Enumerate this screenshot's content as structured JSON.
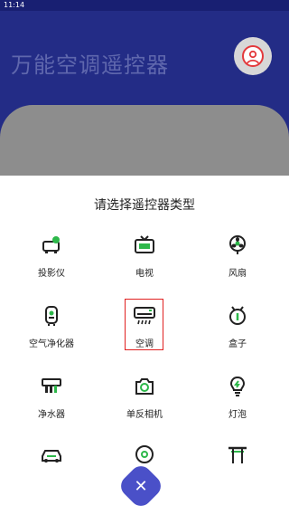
{
  "status_bar": {
    "time": "11:14"
  },
  "header": {
    "title": "万能空调遥控器",
    "avatar_icon": "user-icon"
  },
  "sheet": {
    "title": "请选择遥控器类型",
    "items": [
      {
        "label": "投影仪",
        "icon": "projector-icon"
      },
      {
        "label": "电视",
        "icon": "tv-icon"
      },
      {
        "label": "风扇",
        "icon": "fan-icon"
      },
      {
        "label": "空气净化器",
        "icon": "air-purifier-icon"
      },
      {
        "label": "空调",
        "icon": "air-conditioner-icon"
      },
      {
        "label": "盒子",
        "icon": "set-top-box-icon"
      },
      {
        "label": "净水器",
        "icon": "water-purifier-icon"
      },
      {
        "label": "单反相机",
        "icon": "camera-icon"
      },
      {
        "label": "灯泡",
        "icon": "light-bulb-icon"
      },
      {
        "label": "",
        "icon": "car-icon"
      },
      {
        "label": "",
        "icon": "robot-vacuum-icon"
      },
      {
        "label": "",
        "icon": "gate-icon"
      }
    ],
    "selected": "空调",
    "close_icon": "close-icon"
  },
  "colors": {
    "header": "#232c86",
    "accent": "#4a50c8",
    "icon_green": "#2db84a",
    "highlight": "#e02020"
  }
}
